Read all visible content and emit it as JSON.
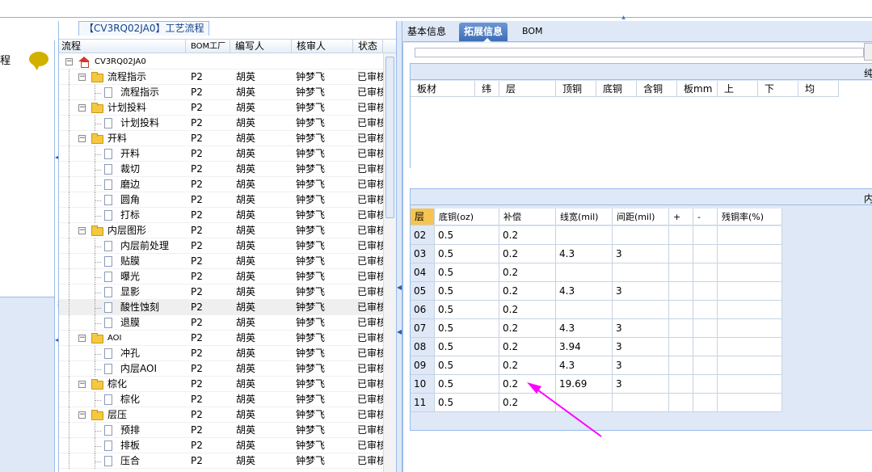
{
  "left_strip": {
    "label": "程"
  },
  "flow_panel": {
    "title": "【CV3RQ02JA0】工艺流程",
    "columns": [
      "流程",
      "BOM工厂",
      "编写人",
      "核审人",
      "状态"
    ],
    "rows": [
      {
        "label": "CV3RQ02JA0",
        "level": 0,
        "type": "root",
        "expander": "−",
        "factory": "",
        "writer": "",
        "reviewer": "",
        "status": ""
      },
      {
        "label": "流程指示",
        "level": 1,
        "type": "folder",
        "expander": "−",
        "factory": "P2",
        "writer": "胡英",
        "reviewer": "钟梦飞",
        "status": "已审核"
      },
      {
        "label": "流程指示",
        "level": 2,
        "type": "doc",
        "factory": "P2",
        "writer": "胡英",
        "reviewer": "钟梦飞",
        "status": "已审核"
      },
      {
        "label": "计划投料",
        "level": 1,
        "type": "folder",
        "expander": "−",
        "factory": "P2",
        "writer": "胡英",
        "reviewer": "钟梦飞",
        "status": "已审核"
      },
      {
        "label": "计划投料",
        "level": 2,
        "type": "doc",
        "factory": "P2",
        "writer": "胡英",
        "reviewer": "钟梦飞",
        "status": "已审核"
      },
      {
        "label": "开料",
        "level": 1,
        "type": "folder",
        "expander": "−",
        "factory": "P2",
        "writer": "胡英",
        "reviewer": "钟梦飞",
        "status": "已审核"
      },
      {
        "label": "开料",
        "level": 2,
        "type": "doc",
        "factory": "P2",
        "writer": "胡英",
        "reviewer": "钟梦飞",
        "status": "已审核"
      },
      {
        "label": "裁切",
        "level": 2,
        "type": "doc",
        "factory": "P2",
        "writer": "胡英",
        "reviewer": "钟梦飞",
        "status": "已审核"
      },
      {
        "label": "磨边",
        "level": 2,
        "type": "doc",
        "factory": "P2",
        "writer": "胡英",
        "reviewer": "钟梦飞",
        "status": "已审核"
      },
      {
        "label": "圆角",
        "level": 2,
        "type": "doc",
        "factory": "P2",
        "writer": "胡英",
        "reviewer": "钟梦飞",
        "status": "已审核"
      },
      {
        "label": "打标",
        "level": 2,
        "type": "doc",
        "factory": "P2",
        "writer": "胡英",
        "reviewer": "钟梦飞",
        "status": "已审核"
      },
      {
        "label": "内层图形",
        "level": 1,
        "type": "folder",
        "expander": "−",
        "factory": "P2",
        "writer": "胡英",
        "reviewer": "钟梦飞",
        "status": "已审核"
      },
      {
        "label": "内层前处理",
        "level": 2,
        "type": "doc",
        "factory": "P2",
        "writer": "胡英",
        "reviewer": "钟梦飞",
        "status": "已审核"
      },
      {
        "label": "贴膜",
        "level": 2,
        "type": "doc",
        "factory": "P2",
        "writer": "胡英",
        "reviewer": "钟梦飞",
        "status": "已审核"
      },
      {
        "label": "曝光",
        "level": 2,
        "type": "doc",
        "factory": "P2",
        "writer": "胡英",
        "reviewer": "钟梦飞",
        "status": "已审核"
      },
      {
        "label": "显影",
        "level": 2,
        "type": "doc",
        "factory": "P2",
        "writer": "胡英",
        "reviewer": "钟梦飞",
        "status": "已审核"
      },
      {
        "label": "酸性蚀刻",
        "level": 2,
        "type": "doc",
        "factory": "P2",
        "writer": "胡英",
        "reviewer": "钟梦飞",
        "status": "已审核",
        "selected": true
      },
      {
        "label": "退膜",
        "level": 2,
        "type": "doc",
        "factory": "P2",
        "writer": "胡英",
        "reviewer": "钟梦飞",
        "status": "已审核"
      },
      {
        "label": "AOI",
        "level": 1,
        "type": "folder",
        "expander": "−",
        "factory": "P2",
        "writer": "胡英",
        "reviewer": "钟梦飞",
        "status": "已审核"
      },
      {
        "label": "冲孔",
        "level": 2,
        "type": "doc",
        "factory": "P2",
        "writer": "胡英",
        "reviewer": "钟梦飞",
        "status": "已审核"
      },
      {
        "label": "内层AOI",
        "level": 2,
        "type": "doc",
        "factory": "P2",
        "writer": "胡英",
        "reviewer": "钟梦飞",
        "status": "已审核"
      },
      {
        "label": "棕化",
        "level": 1,
        "type": "folder",
        "expander": "−",
        "factory": "P2",
        "writer": "胡英",
        "reviewer": "钟梦飞",
        "status": "已审核"
      },
      {
        "label": "棕化",
        "level": 2,
        "type": "doc",
        "factory": "P2",
        "writer": "胡英",
        "reviewer": "钟梦飞",
        "status": "已审核"
      },
      {
        "label": "层压",
        "level": 1,
        "type": "folder",
        "expander": "−",
        "factory": "P2",
        "writer": "胡英",
        "reviewer": "钟梦飞",
        "status": "已审核"
      },
      {
        "label": "预排",
        "level": 2,
        "type": "doc",
        "factory": "P2",
        "writer": "胡英",
        "reviewer": "钟梦飞",
        "status": "已审核"
      },
      {
        "label": "排板",
        "level": 2,
        "type": "doc",
        "factory": "P2",
        "writer": "胡英",
        "reviewer": "钟梦飞",
        "status": "已审核"
      },
      {
        "label": "压合",
        "level": 2,
        "type": "doc",
        "factory": "P2",
        "writer": "胡英",
        "reviewer": "钟梦飞",
        "status": "已审核"
      }
    ]
  },
  "tabs": [
    {
      "label": "基本信息",
      "active": false
    },
    {
      "label": "拓展信息",
      "active": true
    },
    {
      "label": "BOM",
      "active": false
    }
  ],
  "section1": {
    "title": "纯",
    "columns": [
      "板材",
      "纬",
      "层",
      "顶铜",
      "底铜",
      "含铜",
      "板mm",
      "上",
      "下",
      "均"
    ]
  },
  "section2": {
    "title": "内",
    "columns": [
      "层",
      "底铜(oz)",
      "补偿",
      "线宽(mil)",
      "间距(mil)",
      "+",
      "-",
      "残铜率(%)"
    ],
    "rows": [
      [
        "02",
        "0.5",
        "0.2",
        "",
        "",
        "",
        "",
        ""
      ],
      [
        "03",
        "0.5",
        "0.2",
        "4.3",
        "3",
        "",
        "",
        ""
      ],
      [
        "04",
        "0.5",
        "0.2",
        "",
        "",
        "",
        "",
        ""
      ],
      [
        "05",
        "0.5",
        "0.2",
        "4.3",
        "3",
        "",
        "",
        ""
      ],
      [
        "06",
        "0.5",
        "0.2",
        "",
        "",
        "",
        "",
        ""
      ],
      [
        "07",
        "0.5",
        "0.2",
        "4.3",
        "3",
        "",
        "",
        ""
      ],
      [
        "08",
        "0.5",
        "0.2",
        "3.94",
        "3",
        "",
        "",
        ""
      ],
      [
        "09",
        "0.5",
        "0.2",
        "4.3",
        "3",
        "",
        "",
        ""
      ],
      [
        "10",
        "0.5",
        "0.2",
        "19.69",
        "3",
        "",
        "",
        ""
      ],
      [
        "11",
        "0.5",
        "0.2",
        "",
        "",
        "",
        "",
        ""
      ]
    ]
  },
  "colors": {
    "accent": "#3e6db7",
    "panel_bg": "#dfe8f6",
    "border": "#99bbe8",
    "header_cell": "#f6c453",
    "arrow": "#ff00ff"
  }
}
